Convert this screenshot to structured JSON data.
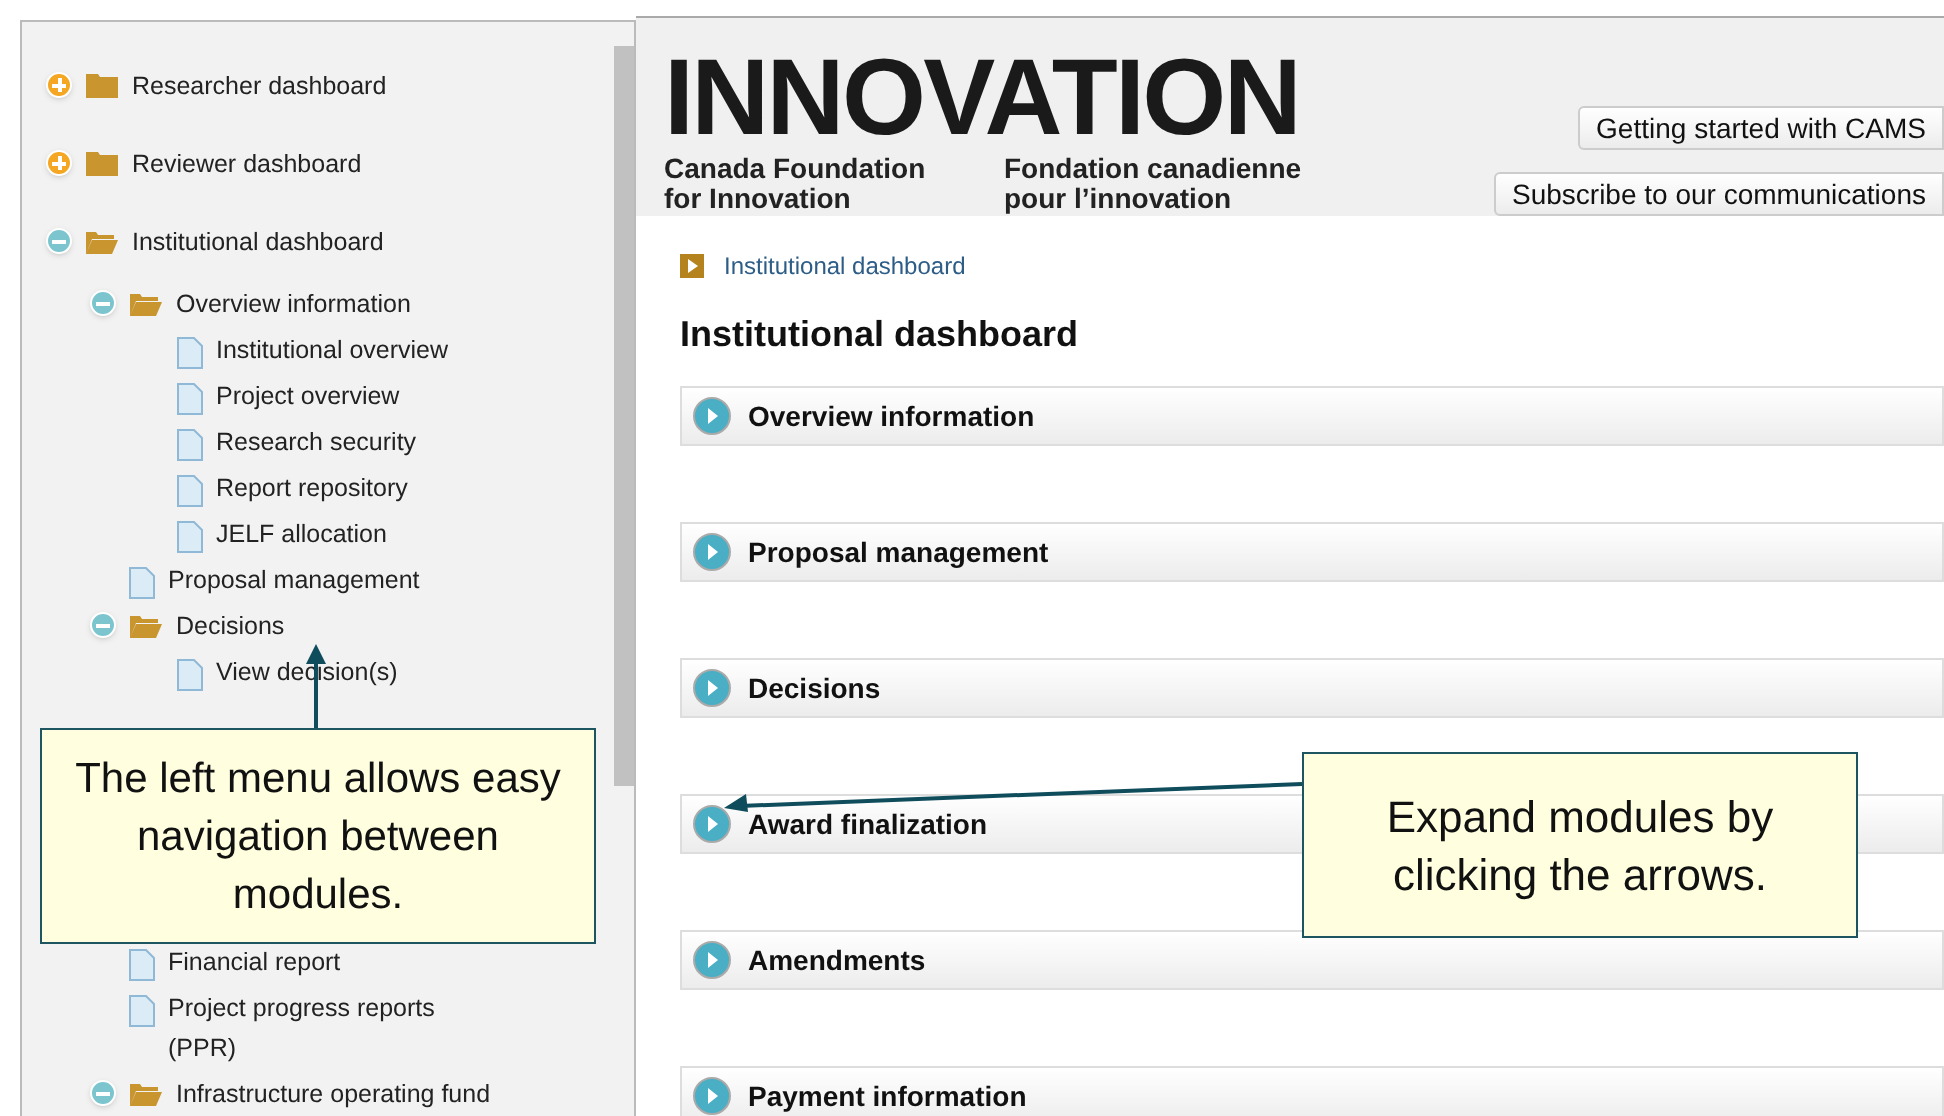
{
  "sidebar": {
    "tree": [
      {
        "label": "Researcher dashboard",
        "expanded": false
      },
      {
        "label": "Reviewer dashboard",
        "expanded": false
      },
      {
        "label": "Institutional dashboard",
        "expanded": true,
        "children": [
          {
            "label": "Overview information",
            "expanded": true,
            "children": [
              {
                "label": "Institutional overview"
              },
              {
                "label": "Project overview"
              },
              {
                "label": "Research security"
              },
              {
                "label": "Report repository"
              },
              {
                "label": "JELF allocation"
              }
            ]
          },
          {
            "label": "Proposal management"
          },
          {
            "label": "Decisions",
            "expanded": true,
            "children": [
              {
                "label": "View decision(s)"
              }
            ]
          },
          {
            "label": "Financial report"
          },
          {
            "label": "Project progress reports (PPR)"
          },
          {
            "label": "Infrastructure operating fund",
            "expanded": true
          }
        ]
      }
    ]
  },
  "header": {
    "logo": {
      "wordmark": "INNOVATION",
      "name_en": "Canada Foundation for Innovation",
      "name_fr": "Fondation canadienne pour l’innovation"
    },
    "links": [
      "Getting started with CAMS",
      "Subscribe to our communications"
    ]
  },
  "breadcrumb": "Institutional dashboard",
  "title": "Institutional dashboard",
  "modules": [
    "Overview information",
    "Proposal management",
    "Decisions",
    "Award finalization",
    "Amendments",
    "Payment information"
  ],
  "callouts": [
    {
      "text": "The left menu allows easy navigation between modules."
    },
    {
      "text": "Expand modules by clicking the arrows."
    }
  ]
}
